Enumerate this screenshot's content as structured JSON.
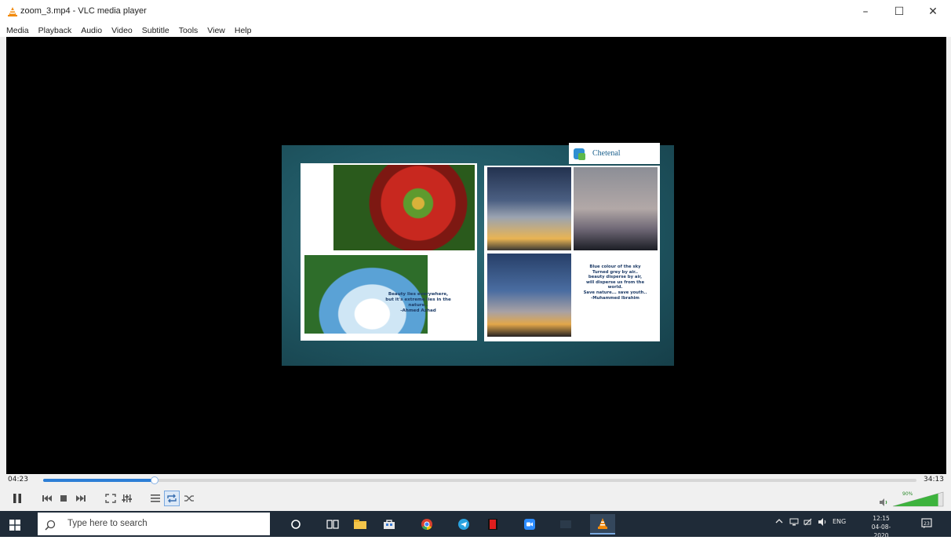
{
  "window": {
    "title": "zoom_3.mp4 - VLC media player",
    "controls": {
      "minimize": "–",
      "maximize": "☐",
      "close": "✕"
    }
  },
  "menu": [
    "Media",
    "Playback",
    "Audio",
    "Video",
    "Subtitle",
    "Tools",
    "View",
    "Help"
  ],
  "slide": {
    "logo_text": "Chetenal",
    "quote_left": [
      "Beauty lies everywhere,",
      "but it's extreme lies in the",
      "nature..",
      "-Ahmed Azhad"
    ],
    "quote_right": [
      "Blue colour of the sky",
      "Turned grey by air..",
      "beauty disperse by air,",
      "will disperse us from the",
      "world.",
      "Save nature... save youth..",
      "-Muhammed Ibrahim"
    ]
  },
  "player": {
    "time_elapsed": "04:23",
    "time_total": "34:13",
    "progress": 0.128,
    "volume_label": "90%",
    "volume": 0.9
  },
  "taskbar": {
    "search_placeholder": "Type here to search",
    "tray_lang": "ENG",
    "clock_time": "12:15",
    "clock_date": "04-08-2020",
    "notifications": "23"
  }
}
